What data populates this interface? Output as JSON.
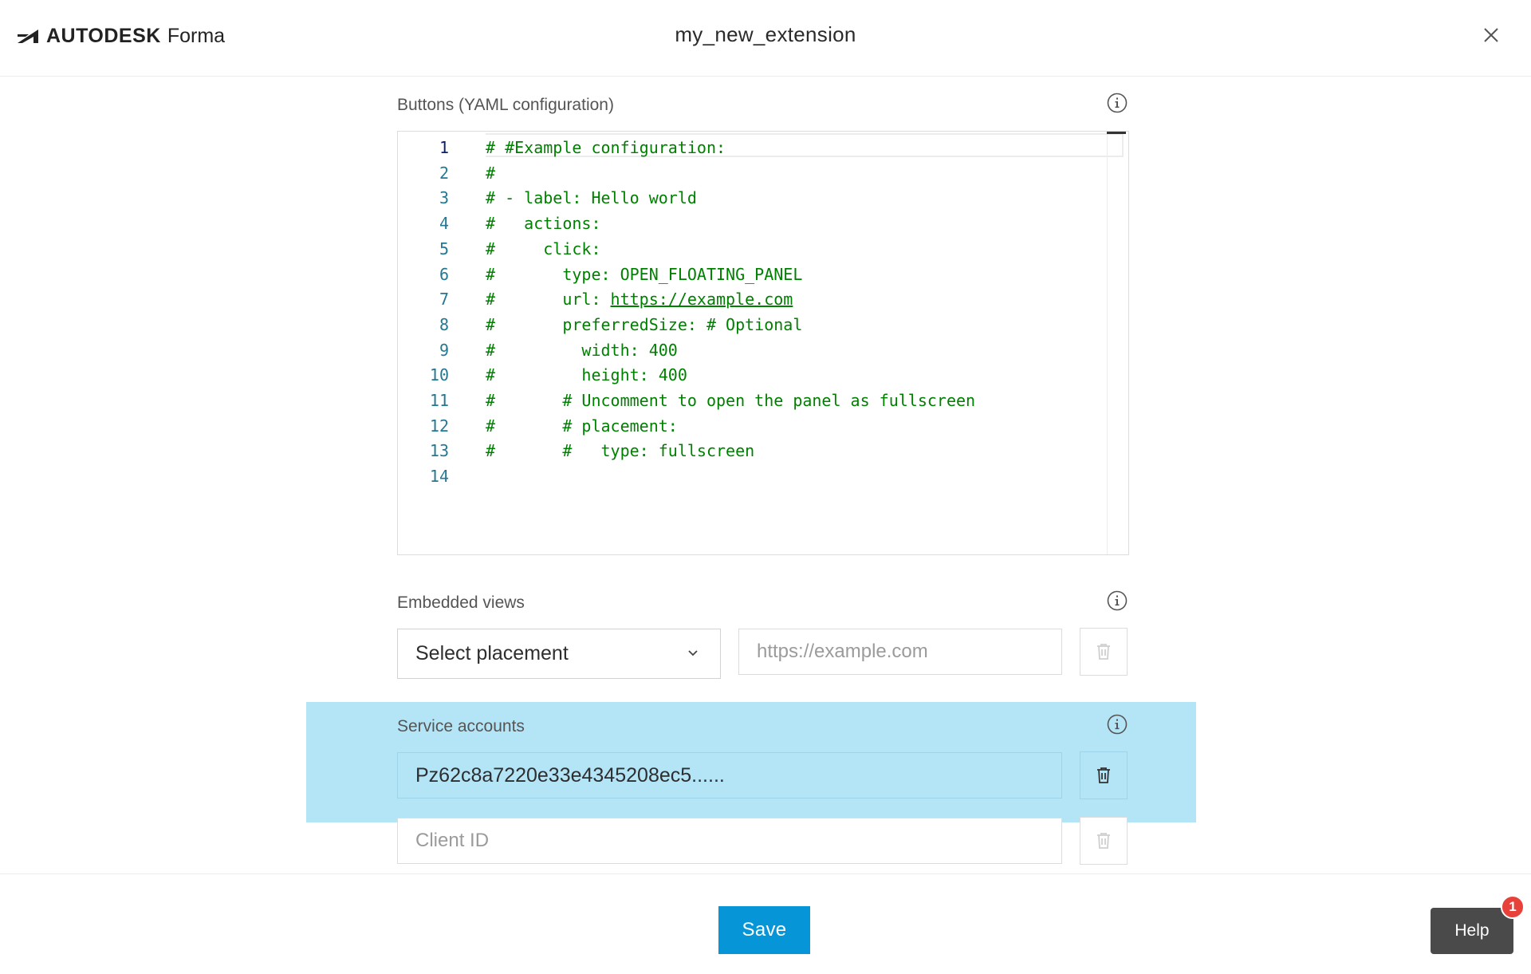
{
  "header": {
    "brand": "AUTODESK",
    "product": "Forma",
    "title": "my_new_extension"
  },
  "buttons_section": {
    "label": "Buttons (YAML configuration)",
    "lines": [
      {
        "n": "1",
        "text": "# #Example configuration:"
      },
      {
        "n": "2",
        "text": "#"
      },
      {
        "n": "3",
        "text": "# - label: Hello world"
      },
      {
        "n": "4",
        "text": "#   actions:"
      },
      {
        "n": "5",
        "text": "#     click:"
      },
      {
        "n": "6",
        "text": "#       type: OPEN_FLOATING_PANEL"
      },
      {
        "n": "7",
        "text": "#       url: ",
        "link": "https://example.com"
      },
      {
        "n": "8",
        "text": "#       preferredSize: # Optional"
      },
      {
        "n": "9",
        "text": "#         width: 400"
      },
      {
        "n": "10",
        "text": "#         height: 400"
      },
      {
        "n": "11",
        "text": "#       # Uncomment to open the panel as fullscreen"
      },
      {
        "n": "12",
        "text": "#       # placement:"
      },
      {
        "n": "13",
        "text": "#       #   type: fullscreen"
      },
      {
        "n": "14",
        "text": ""
      }
    ]
  },
  "embedded_views": {
    "label": "Embedded views",
    "select_value": "Select placement",
    "url_placeholder": "https://example.com"
  },
  "service_accounts": {
    "label": "Service accounts",
    "account_value": "Pz62c8a7220e33e4345208ec5......",
    "client_placeholder": "Client ID"
  },
  "footer": {
    "save_label": "Save",
    "help_label": "Help",
    "help_badge": "1"
  },
  "colors": {
    "accent": "#0696d7",
    "highlight": "#b3e5f7",
    "code_green": "#008000",
    "line_number": "#237893",
    "badge": "#e8413a"
  }
}
